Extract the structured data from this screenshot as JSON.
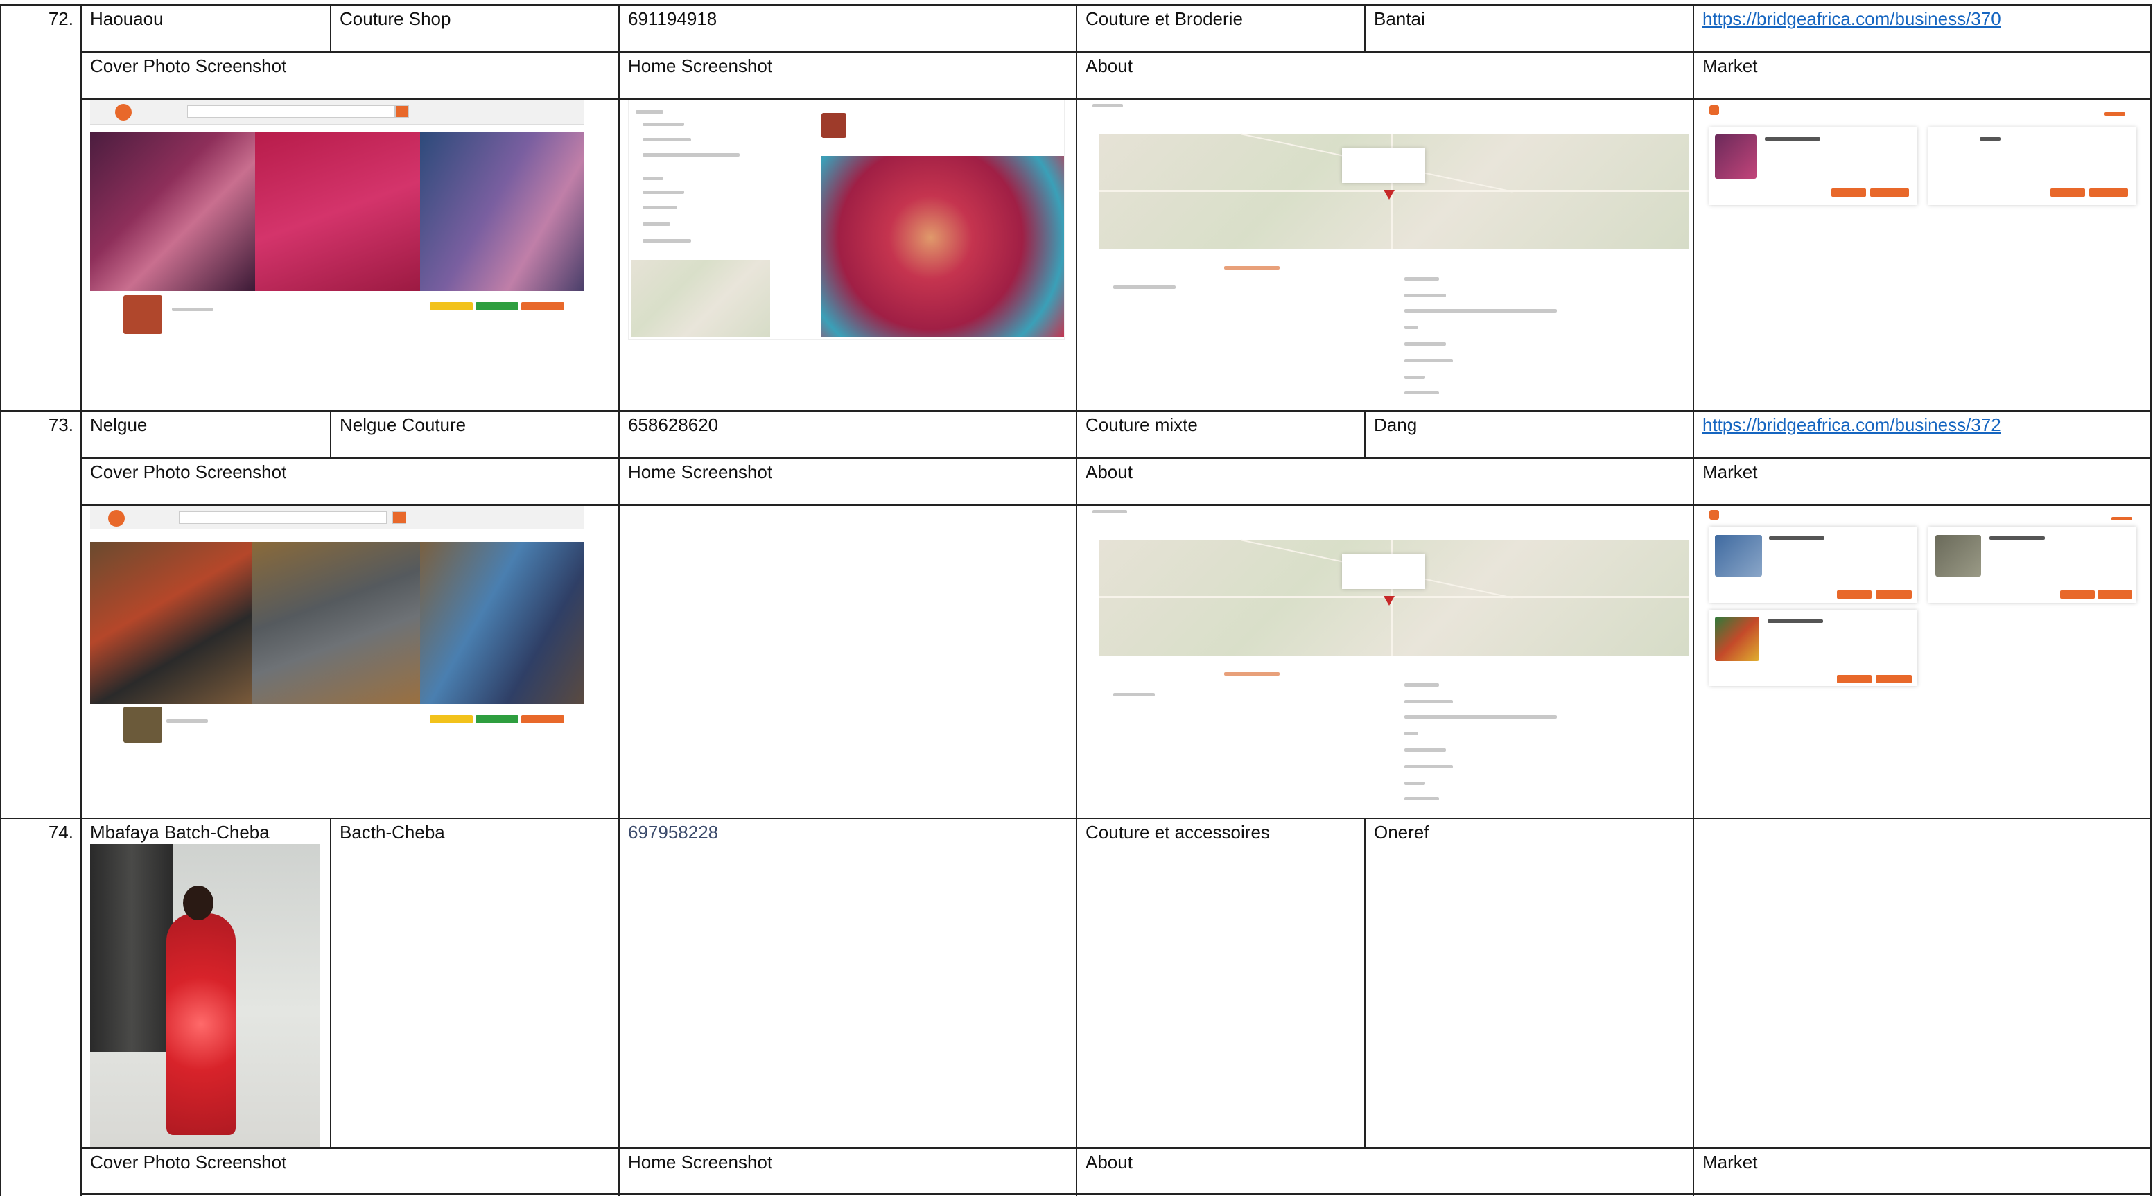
{
  "rows": [
    {
      "number": "72.",
      "name": "Haouaou",
      "business": "Couture Shop",
      "phone": "691194918",
      "activity": "Couture et Broderie",
      "location": "Bantai",
      "link": "https://bridgeafrica.com/business/370"
    },
    {
      "number": "73.",
      "name": "Nelgue",
      "business": "Nelgue Couture",
      "phone": "658628620",
      "activity": "Couture mixte",
      "location": "Dang",
      "link": "https://bridgeafrica.com/business/372"
    },
    {
      "number": "74.",
      "name": "Mbafaya Batch-Cheba",
      "business": "Bacth-Cheba",
      "phone": "697958228",
      "activity": "Couture et accessoires",
      "location": "Oneref",
      "link": ""
    }
  ],
  "subheaders": {
    "cover": "Cover Photo Screenshot",
    "home": "Home Screenshot",
    "about": "About",
    "market": "Market"
  },
  "colors": {
    "accent_orange": "#e8682a",
    "link_blue": "#1565c0",
    "border": "#222222"
  }
}
